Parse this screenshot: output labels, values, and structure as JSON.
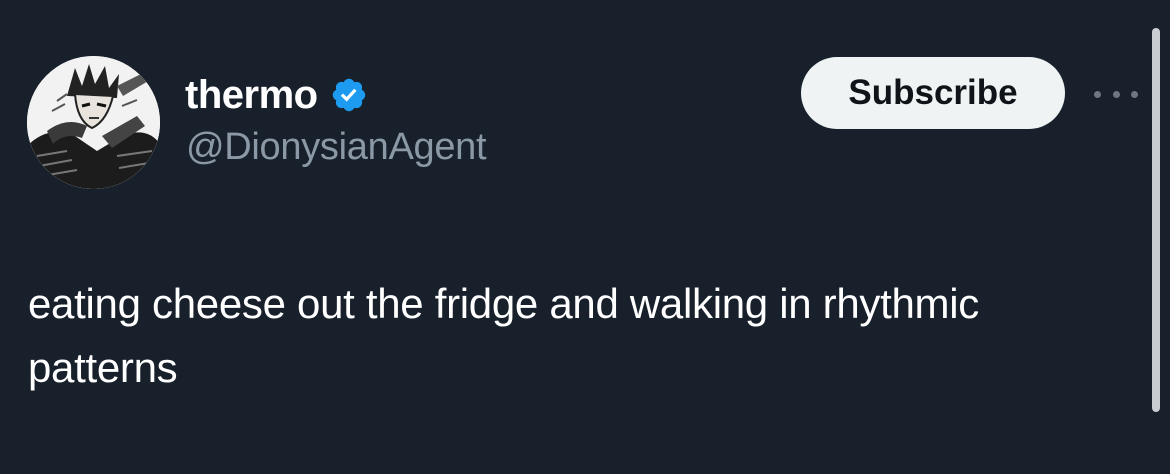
{
  "tweet": {
    "author": {
      "display_name": "thermo",
      "handle": "@DionysianAgent",
      "verified": true,
      "avatar_icon": "manga-character-avatar"
    },
    "subscribe_label": "Subscribe",
    "more_icon": "ellipsis-icon",
    "text": "eating cheese out the fridge and walking in rhythmic patterns"
  },
  "colors": {
    "background": "#17202b",
    "text_primary": "#ffffff",
    "text_secondary": "#8b98a5",
    "verified_blue": "#1d9bf0",
    "button_bg": "#eff3f4"
  }
}
